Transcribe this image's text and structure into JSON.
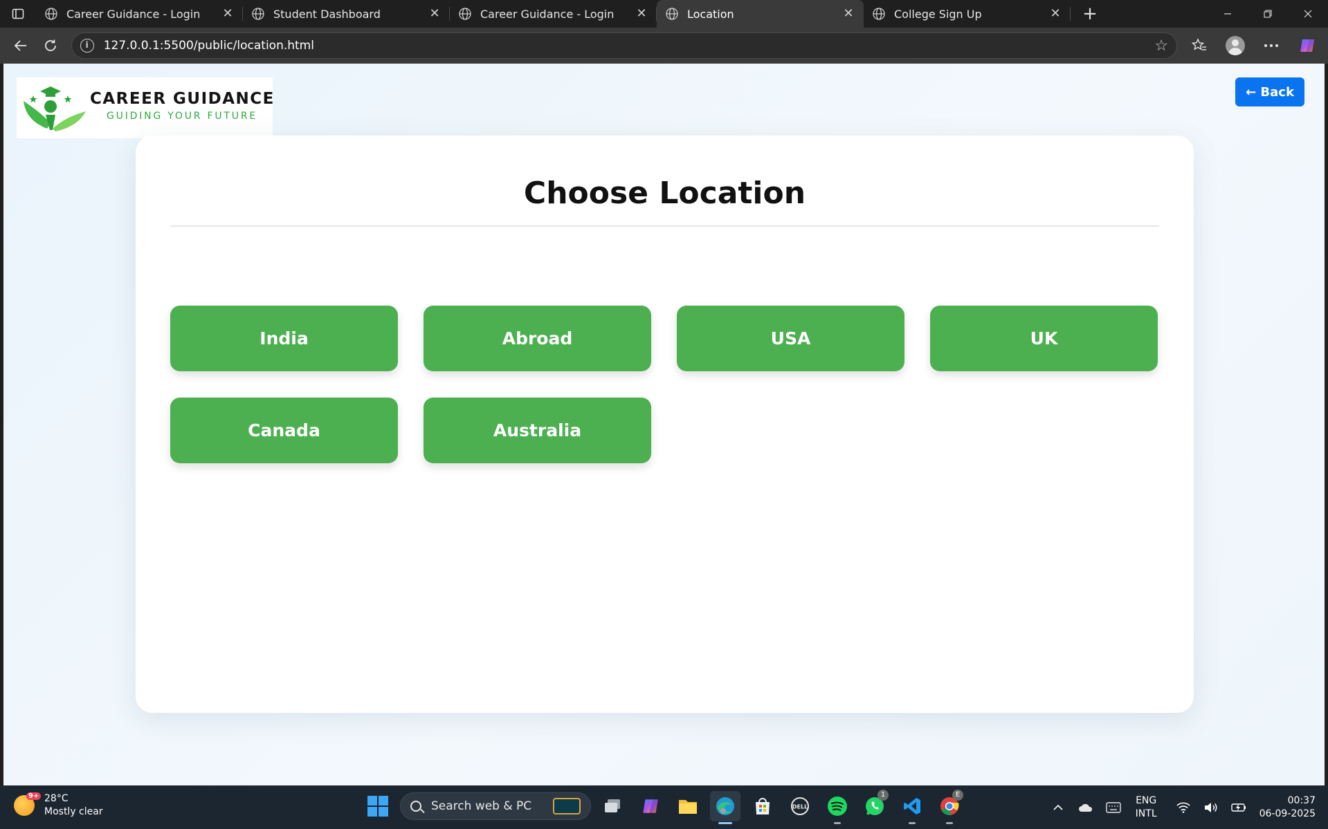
{
  "browser": {
    "tabs": [
      {
        "title": "Career Guidance - Login",
        "active": false
      },
      {
        "title": "Student Dashboard",
        "active": false
      },
      {
        "title": "Career Guidance - Login",
        "active": false
      },
      {
        "title": "Location",
        "active": true
      },
      {
        "title": "College Sign Up",
        "active": false
      }
    ],
    "close_glyph": "✕",
    "new_tab_glyph": "+",
    "url": "127.0.0.1:5500/public/location.html"
  },
  "page": {
    "logo": {
      "brand": "CAREER GUIDANCE",
      "tagline": "GUIDING YOUR FUTURE",
      "colors": {
        "green": "#2eaa3c",
        "text": "#141414"
      }
    },
    "back_label": "← Back",
    "heading": "Choose Location",
    "locations": [
      "India",
      "Abroad",
      "USA",
      "UK",
      "Canada",
      "Australia"
    ],
    "colors": {
      "button_green": "#4caf50",
      "back_blue": "#0a74f0"
    }
  },
  "taskbar": {
    "weather": {
      "temp": "28°C",
      "condition": "Mostly clear",
      "badge": "9+"
    },
    "search_placeholder": "Search web & PC",
    "whatsapp_badge": "1",
    "chrome_badge": "E",
    "language": {
      "line1": "ENG",
      "line2": "INTL"
    },
    "time": "00:37",
    "date": "06-09-2025"
  }
}
